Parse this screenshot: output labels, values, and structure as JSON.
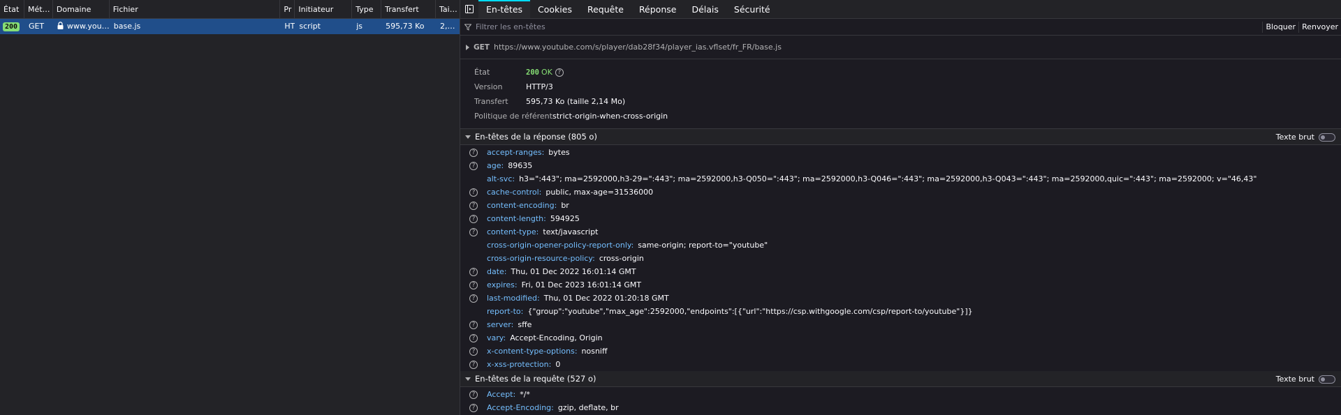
{
  "list": {
    "columns": [
      "État",
      "Mét…",
      "Domaine",
      "Fichier",
      "Pr",
      "Initiateur",
      "Type",
      "Transfert",
      "Tai…"
    ],
    "row": {
      "status": "200",
      "method": "GET",
      "domain": "www.you…",
      "file": "base.js",
      "protocol": "HT",
      "initiator": "script",
      "type": "js",
      "transfer": "595,73 Ko",
      "size": "2,…"
    }
  },
  "tabs": [
    "En-têtes",
    "Cookies",
    "Requête",
    "Réponse",
    "Délais",
    "Sécurité"
  ],
  "filter": {
    "placeholder": "Filtrer les en-têtes",
    "block_label": "Bloquer",
    "resend_label": "Renvoyer"
  },
  "request": {
    "method": "GET",
    "url": "https://www.youtube.com/s/player/dab28f34/player_ias.vflset/fr_FR/base.js"
  },
  "summary": {
    "status_label": "État",
    "status_code": "200",
    "status_text": "OK",
    "version_label": "Version",
    "version_value": "HTTP/3",
    "transfer_label": "Transfert",
    "transfer_value": "595,73 Ko (taille 2,14 Mo)",
    "referrer_label": "Politique de référent",
    "referrer_value": "strict-origin-when-cross-origin"
  },
  "response_headers": {
    "title": "En-têtes de la réponse (805 o)",
    "raw_label": "Texte brut",
    "items": [
      {
        "name": "accept-ranges:",
        "value": "bytes",
        "help": true
      },
      {
        "name": "age:",
        "value": "89635",
        "help": true
      },
      {
        "name": "alt-svc:",
        "value": "h3=\":443\"; ma=2592000,h3-29=\":443\"; ma=2592000,h3-Q050=\":443\"; ma=2592000,h3-Q046=\":443\"; ma=2592000,h3-Q043=\":443\"; ma=2592000,quic=\":443\"; ma=2592000; v=\"46,43\"",
        "help": false
      },
      {
        "name": "cache-control:",
        "value": "public, max-age=31536000",
        "help": true
      },
      {
        "name": "content-encoding:",
        "value": "br",
        "help": true
      },
      {
        "name": "content-length:",
        "value": "594925",
        "help": true
      },
      {
        "name": "content-type:",
        "value": "text/javascript",
        "help": true
      },
      {
        "name": "cross-origin-opener-policy-report-only:",
        "value": "same-origin; report-to=\"youtube\"",
        "help": false
      },
      {
        "name": "cross-origin-resource-policy:",
        "value": "cross-origin",
        "help": false
      },
      {
        "name": "date:",
        "value": "Thu, 01 Dec 2022 16:01:14 GMT",
        "help": true
      },
      {
        "name": "expires:",
        "value": "Fri, 01 Dec 2023 16:01:14 GMT",
        "help": true
      },
      {
        "name": "last-modified:",
        "value": "Thu, 01 Dec 2022 01:20:18 GMT",
        "help": true
      },
      {
        "name": "report-to:",
        "value": "{\"group\":\"youtube\",\"max_age\":2592000,\"endpoints\":[{\"url\":\"https://csp.withgoogle.com/csp/report-to/youtube\"}]}",
        "help": false
      },
      {
        "name": "server:",
        "value": "sffe",
        "help": true
      },
      {
        "name": "vary:",
        "value": "Accept-Encoding, Origin",
        "help": true
      },
      {
        "name": "x-content-type-options:",
        "value": "nosniff",
        "help": true
      },
      {
        "name": "x-xss-protection:",
        "value": "0",
        "help": true
      }
    ]
  },
  "request_headers": {
    "title": "En-têtes de la requête (527 o)",
    "raw_label": "Texte brut",
    "items": [
      {
        "name": "Accept:",
        "value": "*/*",
        "help": true
      },
      {
        "name": "Accept-Encoding:",
        "value": "gzip, deflate, br",
        "help": true
      }
    ]
  },
  "icons": {
    "help": "?"
  }
}
